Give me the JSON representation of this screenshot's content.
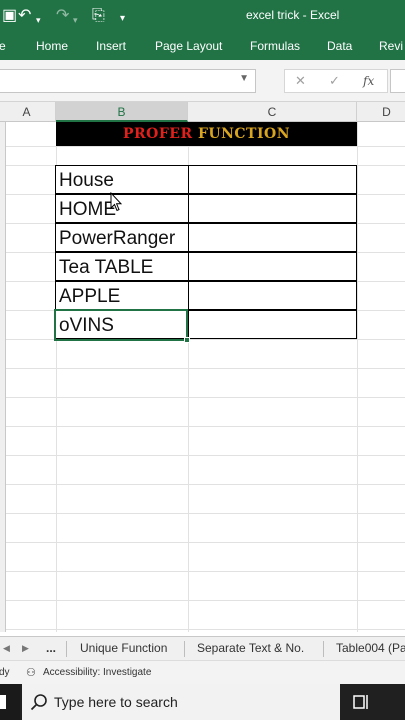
{
  "window": {
    "title": "excel trick - Excel"
  },
  "ribbon": {
    "tabs": [
      "e",
      "Home",
      "Insert",
      "Page Layout",
      "Formulas",
      "Data",
      "Revi"
    ]
  },
  "formula_bar": {
    "cancel": "✕",
    "enter": "✓",
    "fx": "fx"
  },
  "columns": [
    "A",
    "B",
    "C",
    "D"
  ],
  "selected_column": "B",
  "banner": {
    "word1": "PROFER",
    "word2": "FUNCTION"
  },
  "table": {
    "rows": [
      "House",
      "HOME",
      "PowerRanger",
      "Tea TABLE",
      "APPLE",
      "oVINS"
    ]
  },
  "sheet_tabs": {
    "ellipsis": "...",
    "tabs": [
      "Unique Function",
      "Separate Text & No.",
      "Table004 (Pa"
    ]
  },
  "status": {
    "ready": "dy",
    "accessibility": "Accessibility: Investigate"
  },
  "taskbar": {
    "search_placeholder": "Type here to search"
  },
  "colors": {
    "excel_green": "#217346",
    "banner_red": "#e0201b",
    "banner_gold": "#d9a520"
  }
}
